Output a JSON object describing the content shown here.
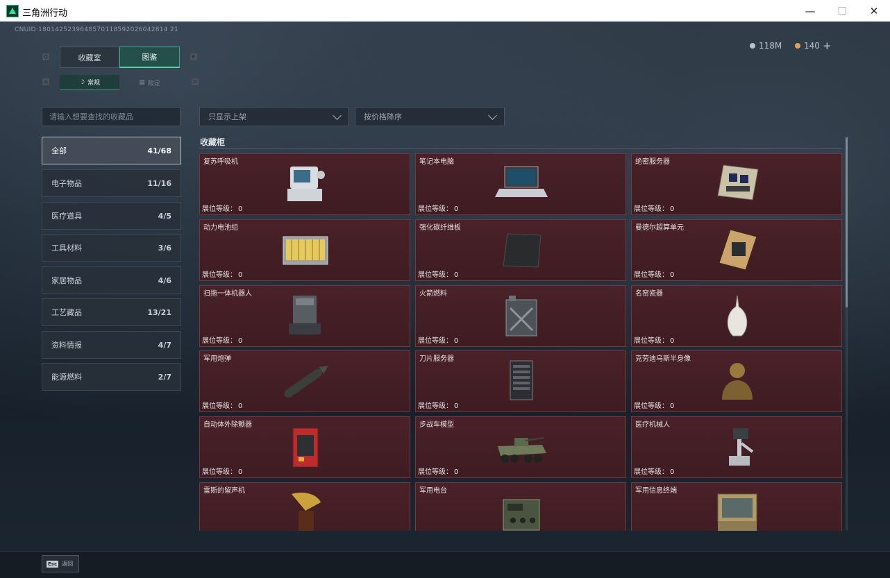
{
  "window": {
    "title": "三角洲行动"
  },
  "header": {
    "uid": "CNUID:1801425239648570118592026042814 21",
    "silver": "118M",
    "gold": "140",
    "plus": "+"
  },
  "tabs": {
    "collection": "收藏室",
    "catalog": "图鉴"
  },
  "subtabs": {
    "normal": "常规",
    "limited": "限定"
  },
  "key_hints": {
    "q": "Q",
    "e": "E",
    "a": "A",
    "d": "D"
  },
  "search": {
    "placeholder": "请输入想要查找的收藏品"
  },
  "filters": {
    "shelf": "只显示上架",
    "sort": "按价格降序"
  },
  "categories": [
    {
      "label": "全部",
      "count": "41/68"
    },
    {
      "label": "电子物品",
      "count": "11/16"
    },
    {
      "label": "医疗道具",
      "count": "4/5"
    },
    {
      "label": "工具材料",
      "count": "3/6"
    },
    {
      "label": "家居物品",
      "count": "4/6"
    },
    {
      "label": "工艺藏品",
      "count": "13/21"
    },
    {
      "label": "资料情报",
      "count": "4/7"
    },
    {
      "label": "能源燃料",
      "count": "2/7"
    }
  ],
  "cabinet": {
    "title": "收藏柜",
    "level_label": "展位等级：",
    "items": [
      {
        "name": "复苏呼吸机",
        "level": "0",
        "icon": "ventilator"
      },
      {
        "name": "笔记本电脑",
        "level": "0",
        "icon": "laptop"
      },
      {
        "name": "绝密服务器",
        "level": "0",
        "icon": "server-board"
      },
      {
        "name": "动力电池组",
        "level": "0",
        "icon": "battery-pack"
      },
      {
        "name": "强化碳纤维板",
        "level": "0",
        "icon": "carbon-plate"
      },
      {
        "name": "曼德尔超算单元",
        "level": "0",
        "icon": "compute-unit"
      },
      {
        "name": "扫拖一体机器人",
        "level": "0",
        "icon": "robot-vacuum"
      },
      {
        "name": "火箭燃料",
        "level": "0",
        "icon": "fuel-can"
      },
      {
        "name": "名窑瓷器",
        "level": "0",
        "icon": "porcelain-vase"
      },
      {
        "name": "军用炮弹",
        "level": "0",
        "icon": "shell"
      },
      {
        "name": "刀片服务器",
        "level": "0",
        "icon": "blade-server"
      },
      {
        "name": "克劳迪乌斯半身像",
        "level": "0",
        "icon": "bust"
      },
      {
        "name": "自动体外除颤器",
        "level": "0",
        "icon": "defibrillator"
      },
      {
        "name": "步战车模型",
        "level": "0",
        "icon": "ifv-model"
      },
      {
        "name": "医疗机械人",
        "level": "0",
        "icon": "medical-robot"
      },
      {
        "name": "雷斯的留声机",
        "level": "",
        "icon": "gramophone"
      },
      {
        "name": "军用电台",
        "level": "",
        "icon": "radio"
      },
      {
        "name": "军用信息终端",
        "level": "",
        "icon": "terminal"
      }
    ]
  },
  "footer": {
    "esc_key": "Esc",
    "esc_label": "返回"
  }
}
